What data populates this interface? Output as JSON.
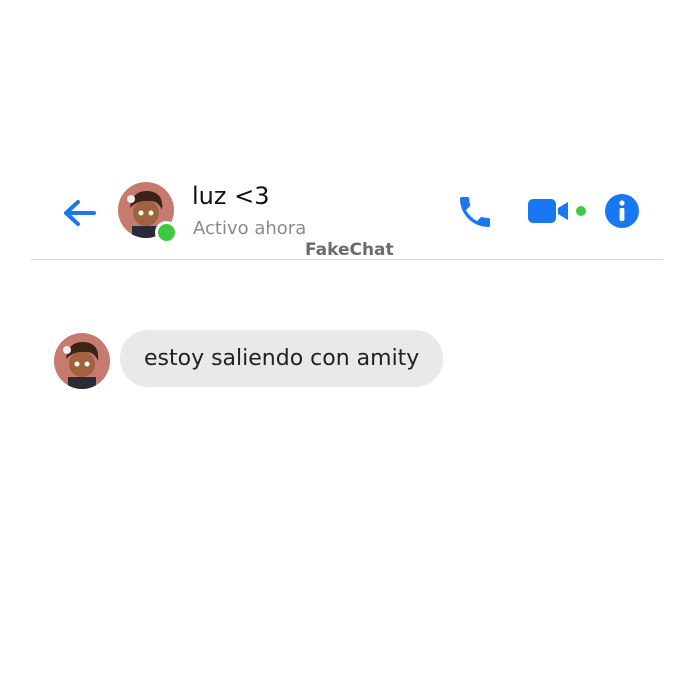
{
  "header": {
    "contact_name": "luz <3",
    "status": "Activo ahora",
    "watermark": "FakeChat",
    "back_icon": "arrow-left-icon",
    "call_icon": "phone-icon",
    "video_icon": "video-camera-icon",
    "info_icon": "info-icon"
  },
  "messages": [
    {
      "sender": "luz <3",
      "text": "estoy saliendo con amity"
    }
  ],
  "colors": {
    "accent": "#1877f2",
    "online": "#3fc93f",
    "bubble": "#e9e9e9"
  }
}
